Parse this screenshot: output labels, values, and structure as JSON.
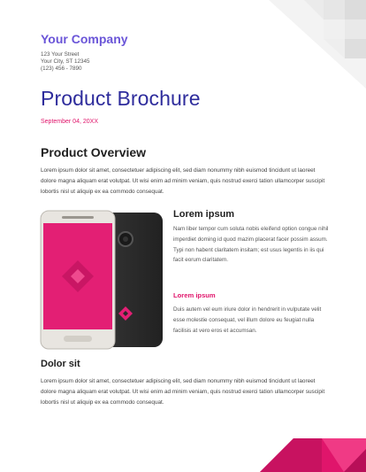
{
  "company": {
    "name": "Your Company",
    "address_line1": "123 Your Street",
    "address_line2": "Your City, ST 12345",
    "phone": "(123) 456 - 7890"
  },
  "document": {
    "title": "Product Brochure",
    "date": "September 04, 20XX"
  },
  "overview": {
    "heading": "Product Overview",
    "body": "Lorem ipsum dolor sit amet, consectetuer adipiscing elit, sed diam nonummy nibh euismod tincidunt ut laoreet dolore magna aliquam erat volutpat. Ut wisi enim ad minim veniam, quis nostrud exerci tation ullamcorper suscipit lobortis nisl ut aliquip ex ea commodo consequat."
  },
  "feature": {
    "heading": "Lorem ipsum",
    "body": "Nam liber tempor cum soluta nobis eleifend option congue nihil imperdiet doming id quod mazim placerat facer possim assum. Typi non habent claritatem insitam; est usus legentis in iis qui facit eorum claritatem.",
    "subheading": "Lorem ipsum",
    "sub_body": "Duis autem vel eum iriure dolor in hendrerit in vulputate velit esse molestie consequat, vel illum dolore eu feugiat nulla facilisis at vero eros et accumsan."
  },
  "dolor": {
    "heading": "Dolor sit",
    "body": "Lorem ipsum dolor sit amet, consectetuer adipiscing elit, sed diam nonummy nibh euismod tincidunt ut laoreet dolore magna aliquam erat volutpat. Ut wisi enim ad minim veniam, quis nostrud exerci tation ullamcorper suscipit lobortis nisl ut aliquip ex ea commodo consequat."
  },
  "colors": {
    "brand_purple": "#6a55d8",
    "title_navy": "#2e2c9c",
    "accent_magenta": "#e0156b",
    "phone_screen_pink": "#e31f74",
    "phone_back": "#2a2a2a"
  },
  "images": {
    "phone": "phone-product-image"
  }
}
